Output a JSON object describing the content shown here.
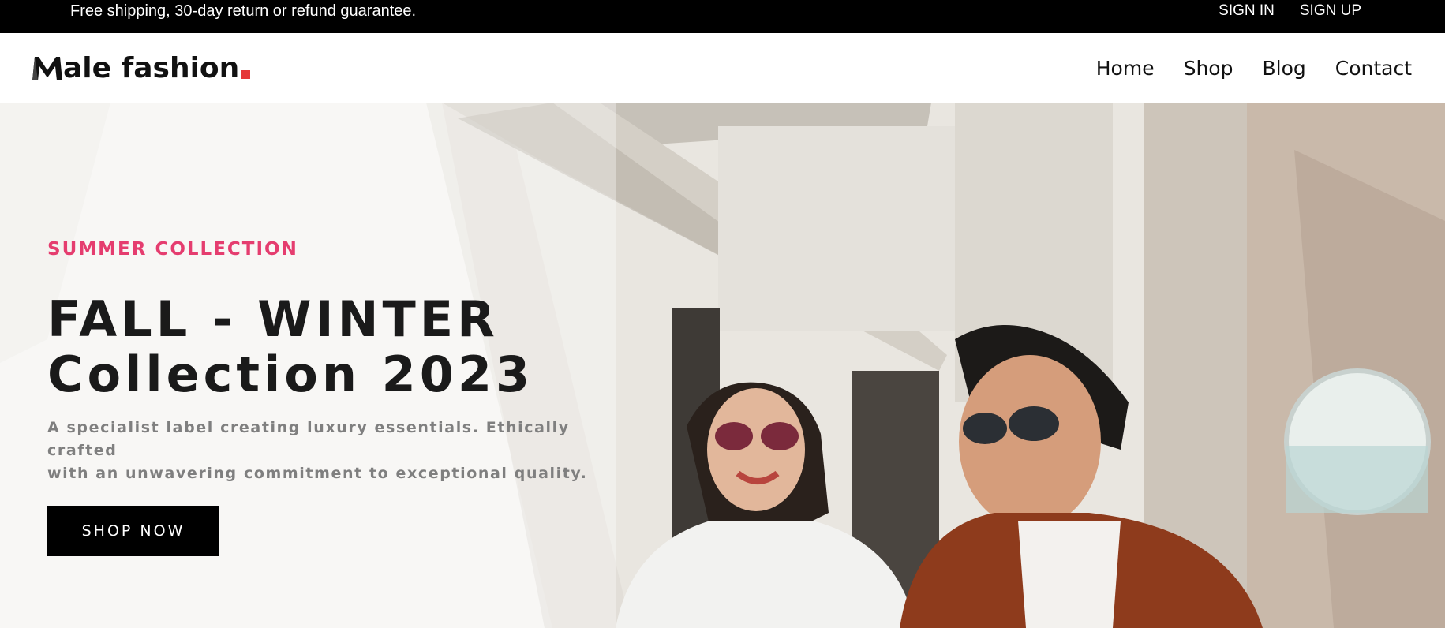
{
  "topbar": {
    "promo_text": "Free shipping, 30-day return or refund guarantee.",
    "sign_in": "SIGN IN",
    "sign_up": "SIGN UP"
  },
  "header": {
    "logo_text": "ale fashion",
    "logo_lettering": "Male fashion.",
    "nav": {
      "home": "Home",
      "shop": "Shop",
      "blog": "Blog",
      "contact": "Contact"
    }
  },
  "hero": {
    "subtitle": "SUMMER COLLECTION",
    "title_line1": "FALL - WINTER",
    "title_line2": "Collection 2023",
    "description_line1": "A specialist label creating luxury essentials. Ethically crafted",
    "description_line2": "with an unwavering commitment to exceptional quality.",
    "cta_label": "SHOP NOW",
    "image_subject": "photo of two people in sunglasses in front of a weathered storefront"
  },
  "colors": {
    "topbar_bg": "#000000",
    "accent_pink": "#e53d6f",
    "logo_dot_red": "#e53637",
    "cta_bg": "#000000",
    "title_text": "#1a1a1a",
    "description_text": "#7f7f7f"
  },
  "icons": {
    "logo_mark": "m-logo-icon"
  }
}
